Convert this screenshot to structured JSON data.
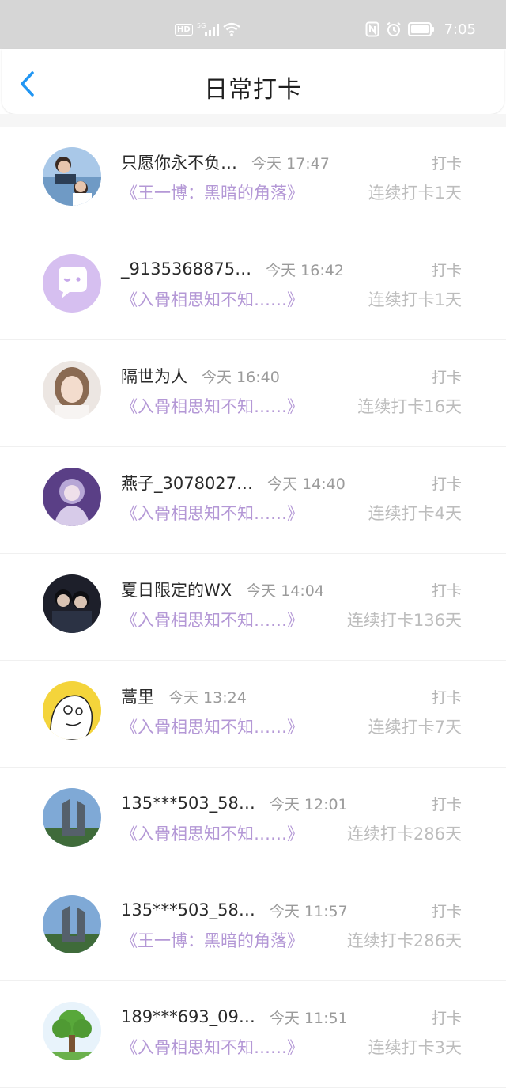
{
  "status_bar": {
    "network_badge": "HD",
    "network_type": "5G",
    "time": "7:05",
    "icons": [
      "signal-icon",
      "wifi-icon",
      "nfc-icon",
      "alarm-icon",
      "battery-icon"
    ]
  },
  "header": {
    "title": "日常打卡",
    "back_icon": "chevron-left-icon"
  },
  "colors": {
    "accent": "#2196f3",
    "book_title": "#b498d6",
    "muted": "#bdbdbd"
  },
  "records": [
    {
      "name": "只愿你永不负…",
      "time": "今天 17:47",
      "action": "打卡",
      "book": "《王一博：黑暗的角落》",
      "streak": "连续打卡1天",
      "avatar": "photo-avatar"
    },
    {
      "name": "_9135368875…",
      "time": "今天 16:42",
      "action": "打卡",
      "book": "《入骨相思知不知……》",
      "streak": "连续打卡1天",
      "avatar": "default-chat-avatar"
    },
    {
      "name": "隔世为人",
      "time": "今天 16:40",
      "action": "打卡",
      "book": "《入骨相思知不知……》",
      "streak": "连续打卡16天",
      "avatar": "photo-avatar"
    },
    {
      "name": "燕子_3078027…",
      "time": "今天 14:40",
      "action": "打卡",
      "book": "《入骨相思知不知……》",
      "streak": "连续打卡4天",
      "avatar": "photo-avatar"
    },
    {
      "name": "夏日限定的WX",
      "time": "今天 14:04",
      "action": "打卡",
      "book": "《入骨相思知不知……》",
      "streak": "连续打卡136天",
      "avatar": "photo-avatar"
    },
    {
      "name": "蒿里",
      "time": "今天 13:24",
      "action": "打卡",
      "book": "《入骨相思知不知……》",
      "streak": "连续打卡7天",
      "avatar": "cartoon-avatar"
    },
    {
      "name": "135***503_58…",
      "time": "今天 12:01",
      "action": "打卡",
      "book": "《入骨相思知不知……》",
      "streak": "连续打卡286天",
      "avatar": "building-avatar"
    },
    {
      "name": "135***503_58…",
      "time": "今天 11:57",
      "action": "打卡",
      "book": "《王一博：黑暗的角落》",
      "streak": "连续打卡286天",
      "avatar": "building-avatar"
    },
    {
      "name": "189***693_09…",
      "time": "今天 11:51",
      "action": "打卡",
      "book": "《入骨相思知不知……》",
      "streak": "连续打卡3天",
      "avatar": "tree-avatar"
    }
  ]
}
